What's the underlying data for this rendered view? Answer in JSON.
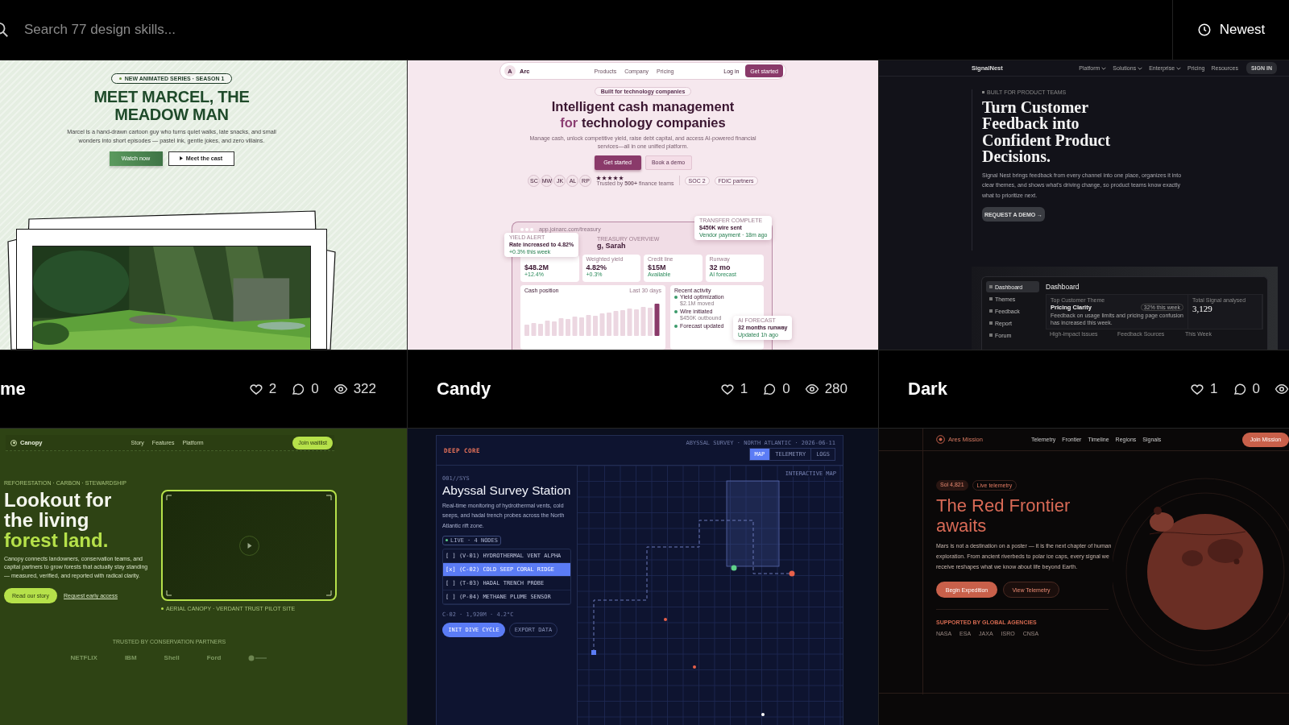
{
  "search": {
    "placeholder": "Search 77 design skills..."
  },
  "sort": {
    "label": "Newest"
  },
  "skills": [
    {
      "title": "me",
      "likes": "2",
      "comments": "0",
      "views": "322",
      "preview": {
        "kind": "meadow",
        "badge": "NEW ANIMATED SERIES · SEASON 1",
        "title": "MEET MARCEL, THE MEADOW MAN",
        "description": "Marcel is a hand-drawn cartoon guy who turns quiet walks, late snacks, and small wonders into short episodes — pastel ink, gentle jokes, and zero villains.",
        "primary": "Watch now",
        "secondary": "Meet the cast"
      }
    },
    {
      "title": "Candy",
      "likes": "1",
      "comments": "0",
      "views": "280",
      "preview": {
        "kind": "candy",
        "logo": "A",
        "brand": "Arc",
        "nav": [
          "Products",
          "Company",
          "Pricing"
        ],
        "login": "Log in",
        "nav_cta": "Get started",
        "pill": "Built for technology companies",
        "title": [
          {
            "text": "Intelligent cash management",
            "accent": false
          },
          {
            "text": "for",
            "accent": true
          },
          {
            "text": "technology companies",
            "accent": false
          }
        ],
        "description": "Manage cash, unlock competitive yield, raise debt capital, and access AI-powered financial services—all in one unified platform.",
        "primary": "Get started",
        "secondary": "Book a demo",
        "avatars": [
          "SC",
          "MW",
          "JK",
          "AL",
          "RP"
        ],
        "stars": 5,
        "trusted": "Trusted by **500+** finance teams",
        "badges": [
          "SOC 2",
          "FDIC partners"
        ],
        "dashboard": {
          "url": "app.joinarc.com/treasury",
          "eyebrow": "TREASURY OVERVIEW",
          "heading": "g, Sarah",
          "alert": {
            "label": "YIELD ALERT",
            "text": "Rate increased to 4.82%",
            "sub": "+0.3% this week"
          },
          "transfer": {
            "label": "TRANSFER COMPLETE",
            "text": "$450K wire sent",
            "sub": "Vendor payment · 18m ago"
          },
          "stats": [
            {
              "value": "$48.2M",
              "delta": "+12.4%"
            },
            {
              "label": "Weighted yield",
              "value": "4.82%",
              "delta": "+0.3%"
            },
            {
              "label": "Credit line",
              "value": "$15M",
              "delta": "Available"
            },
            {
              "label": "Runway",
              "value": "32 mo",
              "delta": "AI forecast"
            }
          ],
          "cash": {
            "title": "Cash position",
            "range": "Last 30 days"
          },
          "activity": {
            "title": "Recent activity",
            "items": [
              {
                "title": "Yield optimization",
                "sub": "$2.1M moved"
              },
              {
                "title": "Wire initiated",
                "sub": "$450K outbound"
              },
              {
                "title": "Forecast updated"
              }
            ]
          },
          "forecast": {
            "label": "AI FORECAST",
            "text": "32 months runway",
            "sub": "Updated 1h ago"
          }
        }
      }
    },
    {
      "title": "Dark",
      "likes": "1",
      "comments": "0",
      "preview": {
        "kind": "dark",
        "brand": "SignalNest",
        "nav": [
          {
            "label": "Platform",
            "dropdown": true
          },
          {
            "label": "Solutions",
            "dropdown": true
          },
          {
            "label": "Enterprise",
            "dropdown": true
          },
          {
            "label": "Pricing",
            "dropdown": false
          },
          {
            "label": "Resources",
            "dropdown": false
          }
        ],
        "signin": "SIGN IN",
        "eyebrow": "BUILT FOR PRODUCT TEAMS",
        "title": "Turn Customer Feedback into Confident Product Decisions.",
        "description": "Signal Nest brings feedback from every channel into one place, organizes it into clear themes, and shows what's driving change, so product teams know exactly what to prioritize next.",
        "cta": "REQUEST A DEMO →",
        "dashboard": {
          "sidebar": [
            {
              "label": "Dashboard",
              "selected": true
            },
            {
              "label": "Themes",
              "selected": false
            },
            {
              "label": "Feedback",
              "selected": false
            },
            {
              "label": "Report",
              "selected": false
            },
            {
              "label": "Forum",
              "selected": false
            }
          ],
          "heading": "Dashboard",
          "theme_label": "Top Customer Theme",
          "theme": "Pricing Clarity",
          "theme_badge": "32% this week",
          "theme_text": "Feedback on usage limits and pricing page confusion has increased this week.",
          "total_label": "Total Signal analysed",
          "total": "3,129",
          "bottom": [
            "High-impact Issues",
            "Feedback Sources",
            "This Week"
          ]
        }
      }
    },
    {
      "preview": {
        "kind": "canopy",
        "brand": "Canopy",
        "nav": [
          "Story",
          "Features",
          "Platform"
        ],
        "nav_cta": "Join waitlist",
        "eyebrow": "REFORESTATION · CARBON · STEWARDSHIP",
        "title": [
          {
            "text": "Lookout for the living",
            "accent": false
          },
          {
            "text": "forest land.",
            "accent": true
          }
        ],
        "description": "Canopy connects landowners, conservation teams, and capital partners to grow forests that actually stay standing — measured, verified, and reported with radical clarity.",
        "primary": "Read our story",
        "link": "Request early access",
        "caption": "AERIAL CANOPY · VERDANT TRUST PILOT SITE",
        "trusted": "TRUSTED BY CONSERVATION PARTNERS",
        "logos": [
          "NETFLIX",
          "IBM",
          "Shell",
          "Ford"
        ]
      }
    },
    {
      "preview": {
        "kind": "deepcore",
        "brand": "DEEP CORE",
        "meta": "ABYSSAL SURVEY · NORTH ATLANTIC · 2026-06-11",
        "tabs": [
          {
            "label": "MAP",
            "selected": true
          },
          {
            "label": "TELEMETRY",
            "selected": false
          },
          {
            "label": "LOGS",
            "selected": false
          }
        ],
        "eyebrow": "001//SYS",
        "title": "Abyssal Survey Station",
        "description": "Real-time monitoring of hydrothermal vents, cold seeps, and hadal trench probes across the North Atlantic rift zone.",
        "live": "LIVE · 4 NODES",
        "nodes": [
          {
            "mark": "[ ]",
            "label": "(V-01) HYDROTHERMAL VENT ALPHA",
            "selected": false
          },
          {
            "mark": "[x]",
            "label": "(C-02) COLD SEEP CORAL RIDGE",
            "selected": true
          },
          {
            "mark": "[ ]",
            "label": "(T-03) HADAL TRENCH PROBE",
            "selected": false
          },
          {
            "mark": "[ ]",
            "label": "(P-04) METHANE PLUME SENSOR",
            "selected": false
          }
        ],
        "readout": "C-02 · 1,920M · 4.2°C",
        "primary": "INIT DIVE CYCLE",
        "secondary": "EXPORT DATA",
        "map_label": "INTERACTIVE MAP"
      }
    },
    {
      "preview": {
        "kind": "mars",
        "brand": "Ares Mission",
        "nav": [
          "Telemetry",
          "Frontier",
          "Timeline",
          "Regions",
          "Signals"
        ],
        "nav_cta": "Join Mission",
        "badges": [
          "Sol 4,821",
          "Live telemetry"
        ],
        "title": "The Red Frontier awaits",
        "description": "Mars is not a destination on a poster — it is the next chapter of human exploration. From ancient riverbeds to polar ice caps, every signal we receive reshapes what we know about life beyond Earth.",
        "primary": "Begin Expedition",
        "secondary": "View Telemetry",
        "supported": "SUPPORTED BY GLOBAL AGENCIES",
        "agencies": [
          "NASA",
          "ESA",
          "JAXA",
          "ISRO",
          "CNSA"
        ]
      }
    }
  ]
}
